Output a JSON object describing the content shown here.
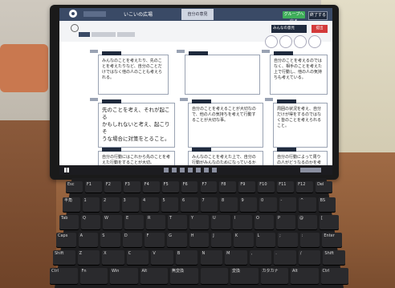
{
  "app": {
    "title": "いこいの広場",
    "tab_label": "自分の意見",
    "green_button": "グループへ戻る",
    "dark_button": "終了する"
  },
  "toolbar": {
    "select_label": "みんなの意見",
    "red_button": "提出"
  },
  "cards": [
    {
      "text": "みんなのことを考えたり、先のことを考えたりなど、自分のことだけではなく他の人のことも考えられる。"
    },
    {
      "text": ""
    },
    {
      "text": "自分のことを考えるのではなく、相手のことを考えた上で行動し、他の人の気持ちも考えている。"
    },
    {
      "text": "先のことを考え、それが起こる\nかもしれないと考え、起こりそ\nうな場合に対策をとること。"
    },
    {
      "text": "自分のことを考えることが大切なので、他の人の気持ちを考えて行動することが大切な事。"
    },
    {
      "text": "周囲の状況を考え、自分だけが得をするのではなく皆のことを考えられること。"
    },
    {
      "text": "自分の行動にはこれから先のことを考えた行動をすることが大切。"
    },
    {
      "text": "みんなのことを考えた上で、自分の行動がみんなのためになっているかを考えること。"
    },
    {
      "text": "自分の行動によって周りの人がどうなるのかを考える。"
    }
  ],
  "keyboard": {
    "rows": [
      [
        "Esc",
        "F1",
        "F2",
        "F3",
        "F4",
        "F5",
        "F6",
        "F7",
        "F8",
        "F9",
        "F10",
        "F11",
        "F12",
        "Del"
      ],
      [
        "半角",
        "1",
        "2",
        "3",
        "4",
        "5",
        "6",
        "7",
        "8",
        "9",
        "0",
        "-",
        "^",
        "BS"
      ],
      [
        "Tab",
        "Q",
        "W",
        "E",
        "R",
        "T",
        "Y",
        "U",
        "I",
        "O",
        "P",
        "@",
        "["
      ],
      [
        "Caps",
        "A",
        "S",
        "D",
        "F",
        "G",
        "H",
        "J",
        "K",
        "L",
        ";",
        ":",
        "Enter"
      ],
      [
        "Shift",
        "Z",
        "X",
        "C",
        "V",
        "B",
        "N",
        "M",
        ",",
        ".",
        "/",
        "Shift"
      ],
      [
        "Ctrl",
        "Fn",
        "Win",
        "Alt",
        "無変換",
        "",
        "変換",
        "カタカナ",
        "Alt",
        "Ctrl"
      ]
    ]
  }
}
